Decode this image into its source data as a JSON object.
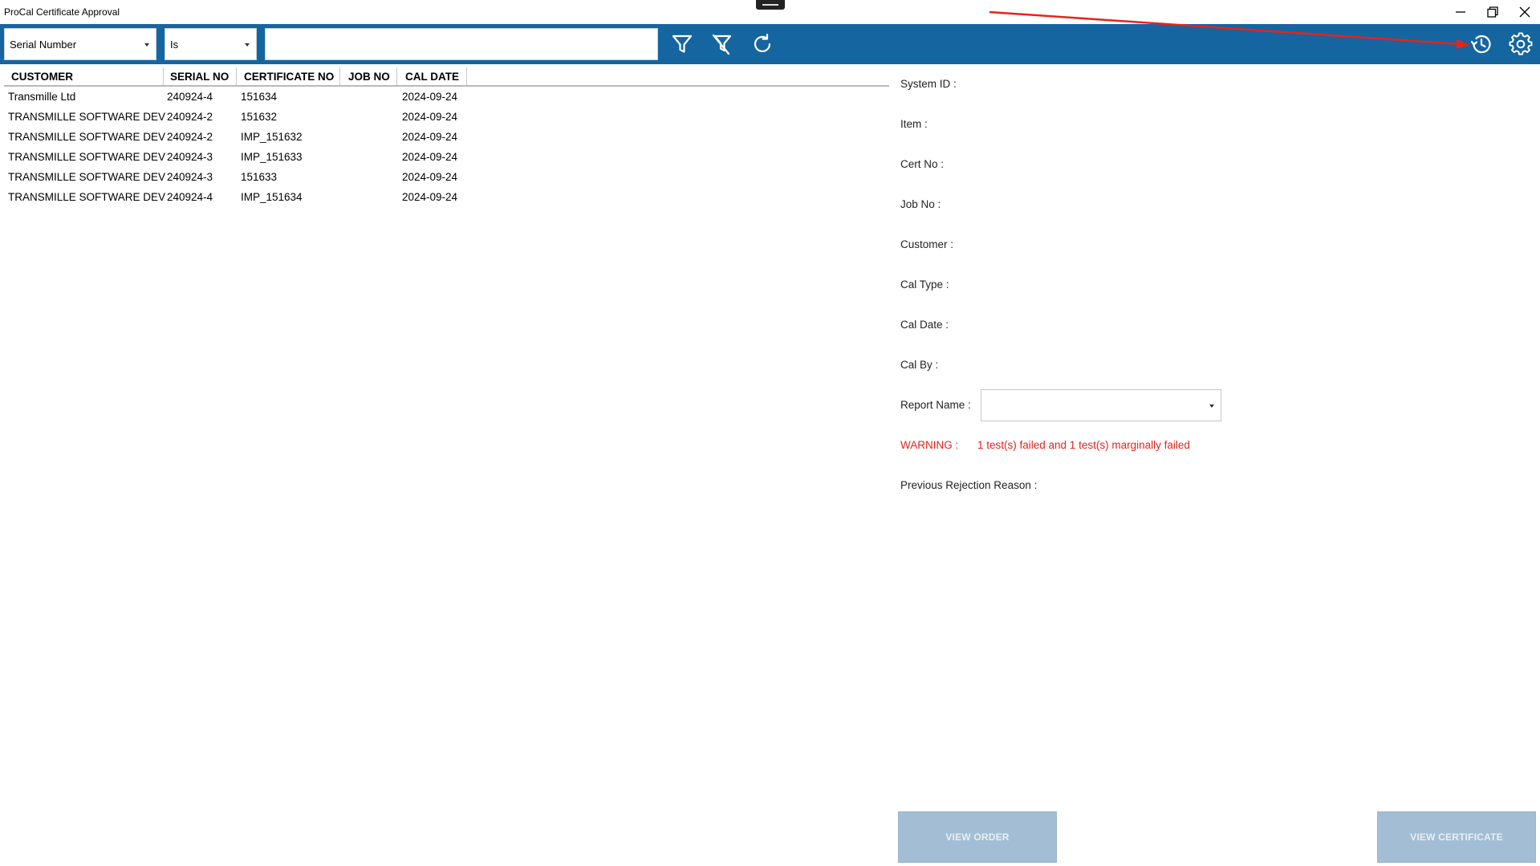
{
  "window": {
    "title": "ProCal Certificate Approval"
  },
  "filter": {
    "field": "Serial Number",
    "operator": "Is",
    "value": ""
  },
  "table": {
    "columns": [
      "CUSTOMER",
      "SERIAL NO",
      "CERTIFICATE NO",
      "JOB NO",
      "CAL DATE"
    ],
    "rows": [
      {
        "customer": "Transmille Ltd",
        "serial": "240924-4",
        "cert": "151634",
        "job": "",
        "date": "2024-09-24"
      },
      {
        "customer": "TRANSMILLE SOFTWARE DEV",
        "serial": "240924-2",
        "cert": "151632",
        "job": "",
        "date": "2024-09-24"
      },
      {
        "customer": "TRANSMILLE SOFTWARE DEV",
        "serial": "240924-2",
        "cert": "IMP_151632",
        "job": "",
        "date": "2024-09-24"
      },
      {
        "customer": "TRANSMILLE SOFTWARE DEV",
        "serial": "240924-3",
        "cert": "IMP_151633",
        "job": "",
        "date": "2024-09-24"
      },
      {
        "customer": "TRANSMILLE SOFTWARE DEV",
        "serial": "240924-3",
        "cert": "151633",
        "job": "",
        "date": "2024-09-24"
      },
      {
        "customer": "TRANSMILLE SOFTWARE DEV",
        "serial": "240924-4",
        "cert": "IMP_151634",
        "job": "",
        "date": "2024-09-24"
      }
    ]
  },
  "details": {
    "system_id": "System ID :",
    "item": "Item :",
    "cert_no": "Cert No :",
    "job_no": "Job No :",
    "customer": "Customer :",
    "cal_type": "Cal Type :",
    "cal_date": "Cal Date :",
    "cal_by": "Cal By :",
    "report_name": "Report Name :",
    "report_value": "",
    "warning_label": "WARNING :",
    "warning_text": "1 test(s) failed and 1 test(s) marginally failed",
    "previous_rejection": "Previous Rejection Reason :"
  },
  "buttons": {
    "view_order": "VIEW ORDER",
    "view_certificate": "VIEW CERTIFICATE"
  },
  "icons": {
    "filter": "filter-icon",
    "clear_filter": "clear-filter-icon",
    "refresh": "refresh-icon",
    "history": "history-icon",
    "settings": "gear-icon"
  },
  "colors": {
    "toolbar": "#1565a0",
    "warning": "#e8221b",
    "disabled_button": "#a3bed4",
    "annotation_arrow": "#e8221b"
  }
}
